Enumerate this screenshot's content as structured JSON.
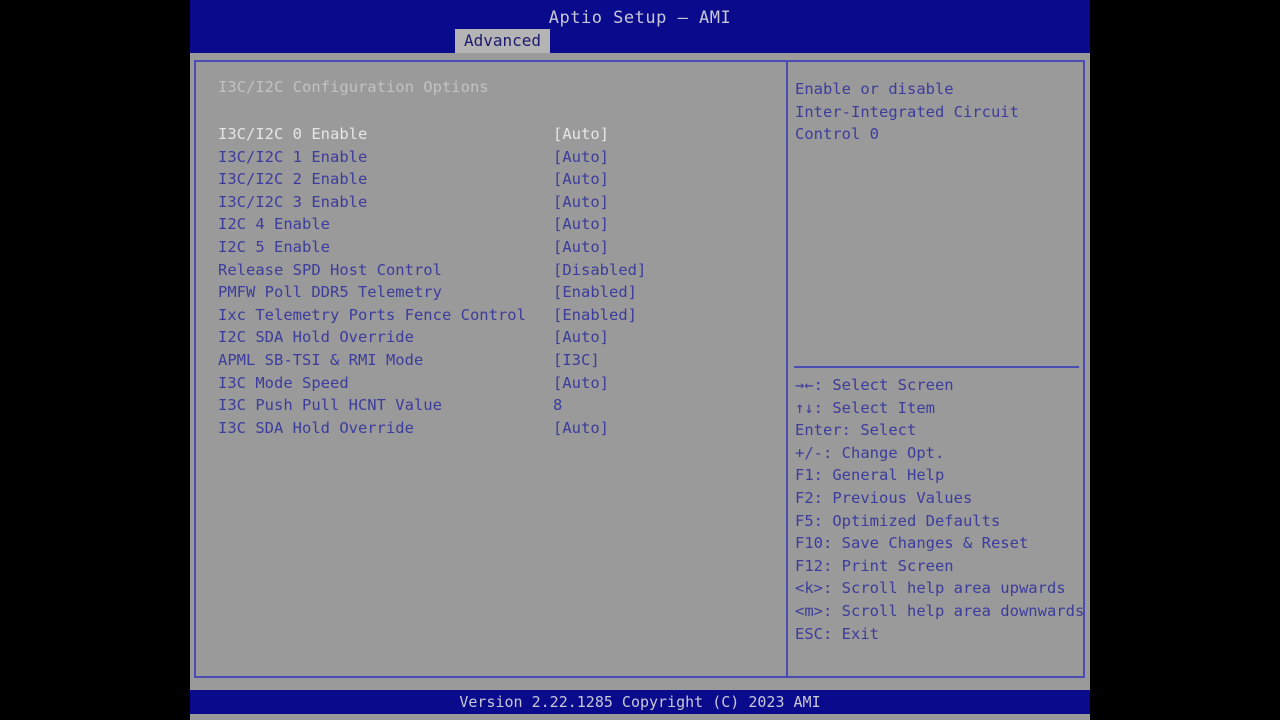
{
  "header": {
    "title": "Aptio Setup – AMI",
    "active_tab": "Advanced"
  },
  "main": {
    "section_title": "I3C/I2C Configuration Options",
    "rows": [
      {
        "label": "I3C/I2C 0 Enable",
        "value": "[Auto]",
        "selected": true
      },
      {
        "label": "I3C/I2C 1 Enable",
        "value": "[Auto]",
        "selected": false
      },
      {
        "label": "I3C/I2C 2 Enable",
        "value": "[Auto]",
        "selected": false
      },
      {
        "label": "I3C/I2C 3 Enable",
        "value": "[Auto]",
        "selected": false
      },
      {
        "label": "I2C 4 Enable",
        "value": "[Auto]",
        "selected": false
      },
      {
        "label": "I2C 5 Enable",
        "value": "[Auto]",
        "selected": false
      },
      {
        "label": "Release SPD Host Control",
        "value": "[Disabled]",
        "selected": false
      },
      {
        "label": "PMFW Poll DDR5 Telemetry",
        "value": "[Enabled]",
        "selected": false
      },
      {
        "label": "Ixc Telemetry Ports Fence Control",
        "value": "[Enabled]",
        "selected": false
      },
      {
        "label": "I2C SDA Hold Override",
        "value": "[Auto]",
        "selected": false
      },
      {
        "label": "APML SB-TSI & RMI Mode",
        "value": "[I3C]",
        "selected": false
      },
      {
        "label": "I3C Mode Speed",
        "value": "[Auto]",
        "selected": false
      },
      {
        "label": "I3C Push Pull HCNT Value",
        "value": "8",
        "selected": false
      },
      {
        "label": "I3C SDA Hold Override",
        "value": "[Auto]",
        "selected": false
      }
    ]
  },
  "help": {
    "description_lines": [
      "Enable or disable",
      "Inter-Integrated Circuit",
      "Control 0"
    ],
    "keys": [
      "→←: Select Screen",
      "↑↓: Select Item",
      "Enter: Select",
      "+/-: Change Opt.",
      "F1: General Help",
      "F2: Previous Values",
      "F5: Optimized Defaults",
      "F10: Save Changes & Reset",
      "F12: Print Screen",
      "<k>: Scroll help area upwards",
      "<m>: Scroll help area downwards",
      "ESC: Exit"
    ]
  },
  "footer": {
    "version": "Version 2.22.1285 Copyright (C) 2023 AMI"
  },
  "colors": {
    "background": "#9a9a9a",
    "bar_blue": "#0a0a8c",
    "text_blue": "#3c3c9c",
    "border_blue": "#4b4bb4",
    "selected_text": "#e6e6e6"
  }
}
